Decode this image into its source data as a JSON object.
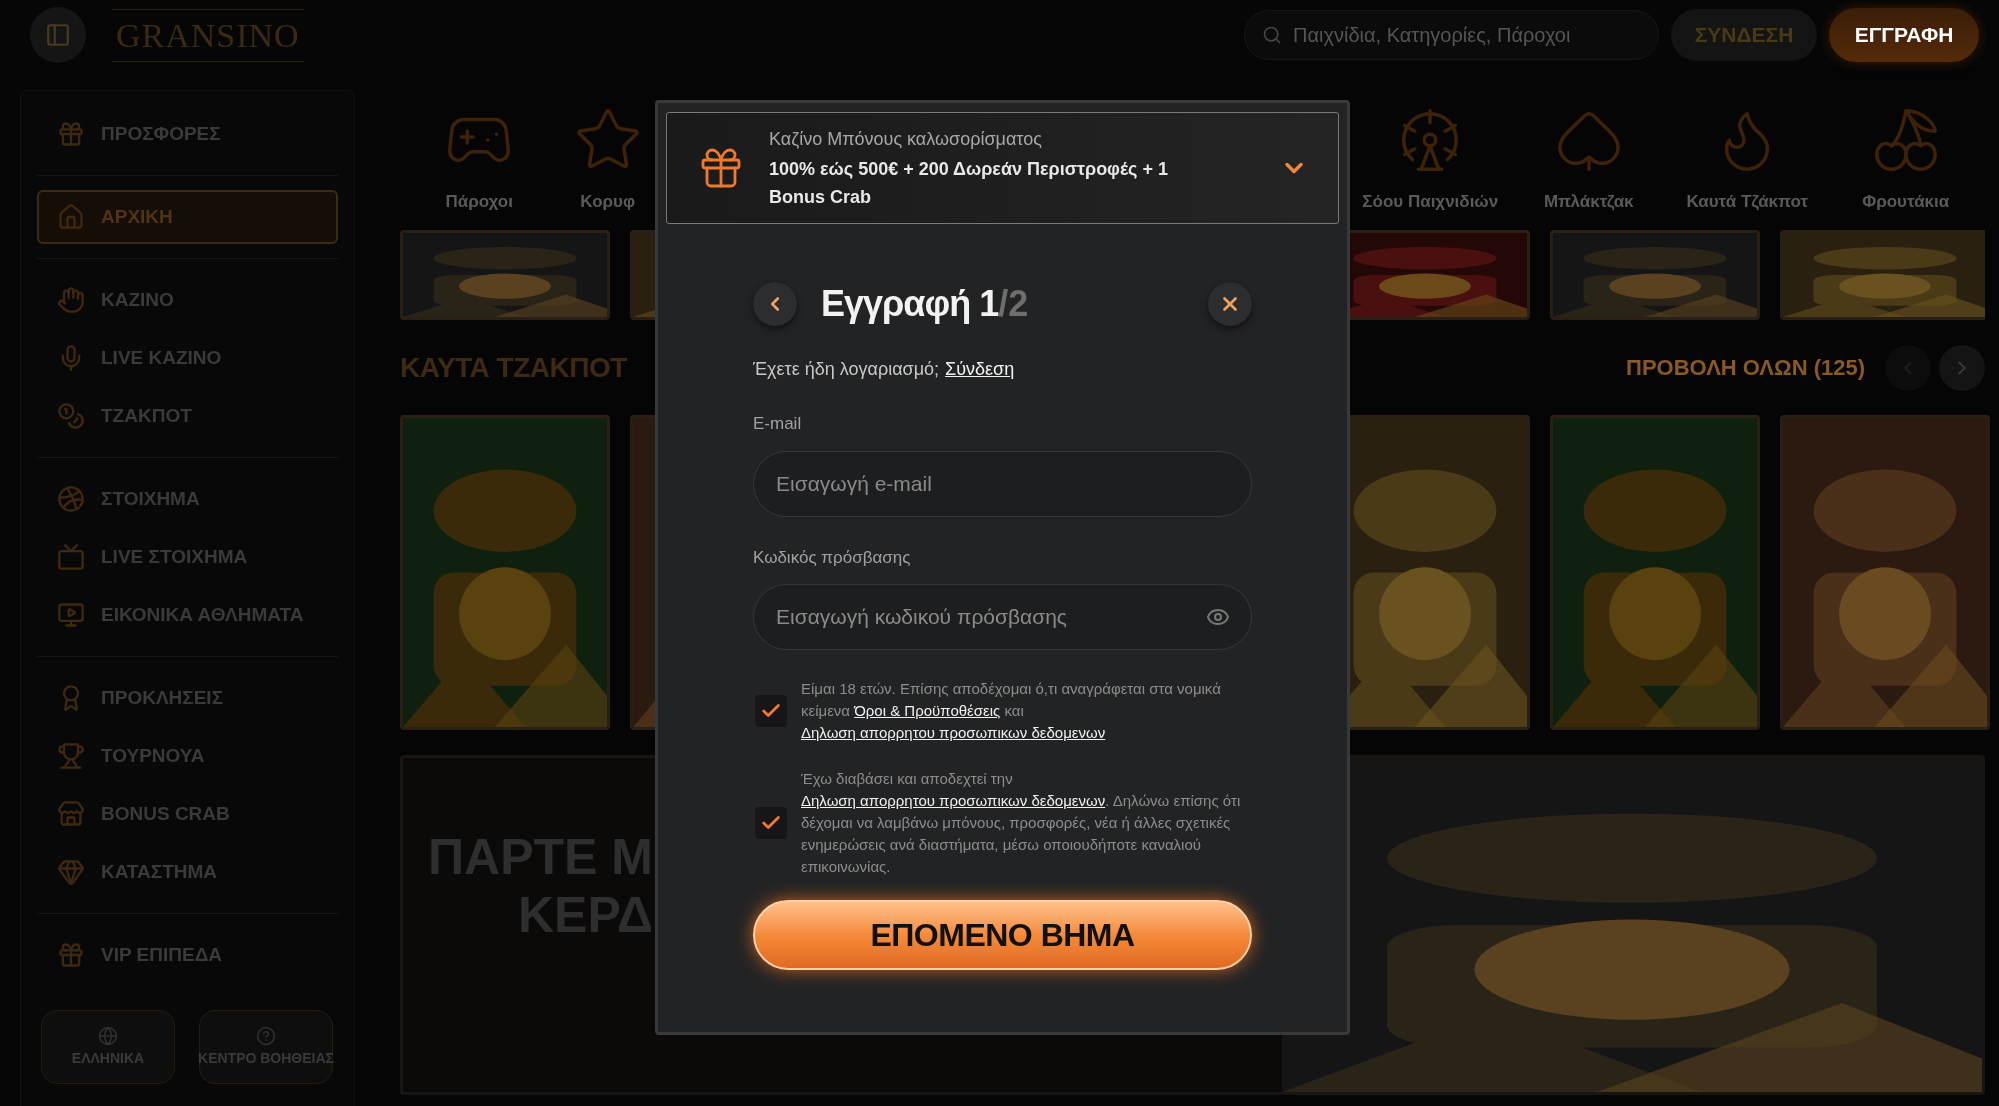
{
  "header": {
    "logo": "GRANSINO",
    "search": {
      "placeholder": "Παιχνίδια, Κατηγορίες, Πάροχοι"
    },
    "login": "ΣΥΝΔΕΣΗ",
    "register": "ΕΓΓΡΑΦΗ"
  },
  "sidebar": {
    "groups": [
      [
        {
          "label": "ΠΡΟΣΦΟΡΕΣ",
          "selected": false
        }
      ],
      [
        {
          "label": "ΑΡΧΙΚΗ",
          "selected": true
        }
      ],
      [
        {
          "label": "ΚΑΖΙΝΟ",
          "selected": false
        },
        {
          "label": "LIVE ΚΑΖΙΝΟ",
          "selected": false
        },
        {
          "label": "ΤΖΑΚΠΟΤ",
          "selected": false
        }
      ],
      [
        {
          "label": "ΣΤΟΙΧΗΜΑ",
          "selected": false
        },
        {
          "label": "LIVE ΣΤΟΙΧΗΜΑ",
          "selected": false
        },
        {
          "label": "ΕΙΚΟΝΙΚΑ ΑΘΛΗΜΑΤΑ",
          "selected": false
        }
      ],
      [
        {
          "label": "ΠΡΟΚΛΗΣΕΙΣ",
          "selected": false
        },
        {
          "label": "ΤΟΥΡΝΟΥΑ",
          "selected": false
        },
        {
          "label": "BONUS CRAB",
          "selected": false
        },
        {
          "label": "ΚΑΤΑΣΤΗΜΑ",
          "selected": false
        }
      ],
      [
        {
          "label": "VIP ΕΠΙΠΕΔΑ",
          "selected": false
        }
      ]
    ],
    "buttons": [
      "ΕΛΛΗΝΙΚΑ",
      "ΚΕΝΤΡΟ ΒΟΗΘΕΙΑΣ"
    ]
  },
  "categories": [
    "Πάροχοι",
    "Κορυφ",
    "Σόου Παιχνιδιών",
    "Μπλάκτζακ",
    "Καυτά Τζάκποτ",
    "Φρουτάκια"
  ],
  "section": {
    "title": "ΚΑΥΤΑ ΤΖΑΚΠΟΤ",
    "view_all": "ΠΡΟΒΟΛΗ ΟΛΩΝ (125)"
  },
  "banner": {
    "lines": [
      "ΠΑΡΤΕ Μ",
      "ΚΕΡΔ"
    ]
  },
  "modal": {
    "bonus": {
      "label": "Καζίνο Μπόνους καλωσορίσματος",
      "offer": "100% εώς 500€ + 200 Δωρεάν Περιστροφές + 1 Bonus Crab"
    },
    "title": "Εγγραφή 1",
    "step_total": "/2",
    "login_prompt": {
      "text": "Έχετε ήδη λογαριασμό;",
      "link": "Σύνδεση"
    },
    "fields": [
      {
        "kind": "email",
        "label": "E-mail",
        "placeholder": "Εισαγωγή e-mail"
      },
      {
        "kind": "password",
        "label": "Κωδικός πρόσβασης",
        "placeholder": "Εισαγωγή κωδικού πρόσβασης"
      }
    ],
    "consents": [
      {
        "checked": true,
        "segments": [
          {
            "kind": "text",
            "text": "Είμαι 18 ετών. Επίσης αποδέχομαι ό,τι αναγράφεται στα νομικά κείμενα "
          },
          {
            "kind": "link",
            "text": "Όροι & Προϋποθέσεις"
          },
          {
            "kind": "text",
            "text": " και "
          },
          {
            "kind": "link",
            "text": "Δηλωση απορρητου προσωπικων δεδομενων"
          }
        ]
      },
      {
        "checked": true,
        "segments": [
          {
            "kind": "text",
            "text": "Έχω διαβάσει και αποδεχτεί την "
          },
          {
            "kind": "link",
            "text": "Δηλωση απορρητου προσωπικων δεδομενων"
          },
          {
            "kind": "text",
            "text": ". Δηλώνω επίσης ότι δέχομαι να λαμβάνω μπόνους, προσφορές, νέα ή άλλες σχετικές ενημερώσεις ανά διαστήματα, μέσω οποιουδήποτε καναλιού επικοινωνίας."
          }
        ]
      }
    ],
    "submit": "ΕΠΟΜΕΝΟ ΒΗΜΑ"
  }
}
